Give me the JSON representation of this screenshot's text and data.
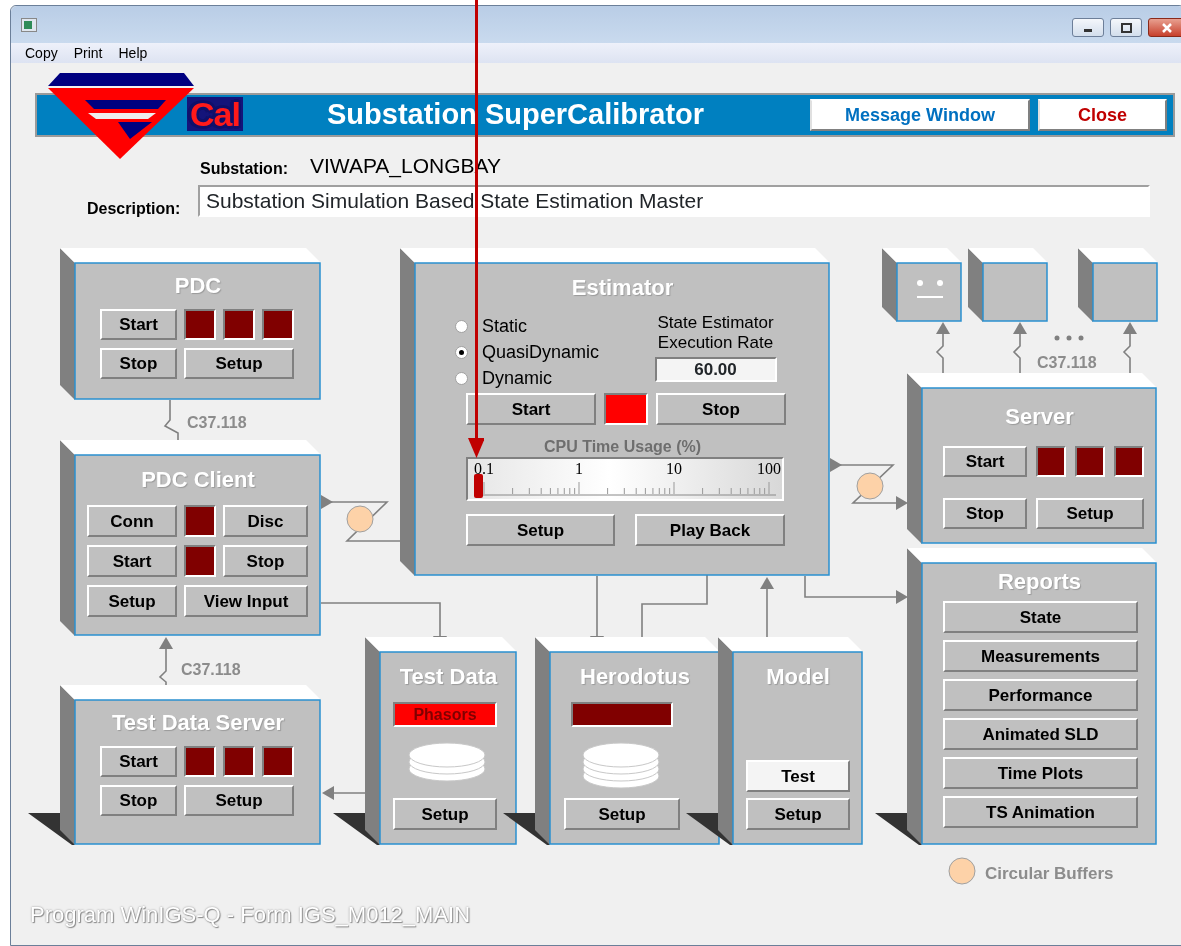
{
  "menu": [
    {
      "label": "Copy"
    },
    {
      "label": "Print"
    },
    {
      "label": "Help"
    }
  ],
  "header": {
    "logo_text": "Cal",
    "title": "Substation SuperCalibrator",
    "buttons": [
      {
        "label": "Message Window",
        "kind": "info"
      },
      {
        "label": "Close",
        "kind": "danger"
      }
    ]
  },
  "substation": {
    "label": "Substation:",
    "value": "VIWAPA_LONGBAY"
  },
  "description": {
    "label": "Description:",
    "value": "Substation Simulation Based State Estimation Master"
  },
  "pdc": {
    "title": "PDC",
    "buttons": [
      "Start",
      "Stop",
      "Setup"
    ],
    "indicators": [
      {
        "on": false
      },
      {
        "on": false
      },
      {
        "on": false
      }
    ]
  },
  "pdc_link": {
    "label": "C37.118"
  },
  "pdc_client": {
    "title": "PDC Client",
    "buttons": [
      "Conn",
      "Disc",
      "Start",
      "Stop",
      "Setup",
      "View Input"
    ],
    "indicators": [
      {
        "on": false
      },
      {
        "on": false
      }
    ]
  },
  "test_data_link": {
    "label": "C37.118"
  },
  "test_data_server": {
    "title": "Test Data Server",
    "buttons": [
      "Start",
      "Stop",
      "Setup"
    ],
    "indicators": [
      {
        "on": false
      },
      {
        "on": false
      },
      {
        "on": false
      }
    ]
  },
  "estimator": {
    "title": "Estimator",
    "modes": [
      {
        "label": "Static",
        "selected": false
      },
      {
        "label": "QuasiDynamic",
        "selected": true
      },
      {
        "label": "Dynamic",
        "selected": false
      }
    ],
    "rate": {
      "label": "State Estimator Execution Rate",
      "value": "60.00"
    },
    "start": "Start",
    "indicator": {
      "on": true
    },
    "stop": "Stop",
    "cpu": {
      "title": "CPU Time Usage (%)",
      "level": 0.03,
      "ticks": [
        "0.1",
        "1",
        "10",
        "100"
      ]
    },
    "buttons": [
      "Setup",
      "Play Back"
    ]
  },
  "test_data": {
    "title": "Test Data",
    "indicator": {
      "label": "Phasors",
      "on": true
    },
    "setup": "Setup"
  },
  "herodotus": {
    "title": "Herodotus",
    "indicator": {
      "on": false
    },
    "setup": "Setup"
  },
  "model": {
    "title": "Model",
    "test": {
      "label": "Test",
      "highlighted": true
    },
    "setup": "Setup"
  },
  "clients": [
    {
      "kind": "face"
    },
    {
      "kind": "blank"
    },
    {
      "kind": "blank"
    }
  ],
  "server_link": {
    "label": "C37.118"
  },
  "server": {
    "title": "Server",
    "buttons": [
      "Start",
      "Stop",
      "Setup"
    ],
    "indicators": [
      {
        "on": false
      },
      {
        "on": false
      },
      {
        "on": false
      }
    ]
  },
  "reports": {
    "title": "Reports",
    "buttons": [
      "State",
      "Measurements",
      "Performance",
      "Animated SLD",
      "Time Plots",
      "TS Animation"
    ]
  },
  "legend": {
    "label": "Circular Buffers"
  },
  "footer": "Program WinIGS-Q - Form IGS_M012_MAIN",
  "annotation": {
    "kind": "arrow"
  }
}
